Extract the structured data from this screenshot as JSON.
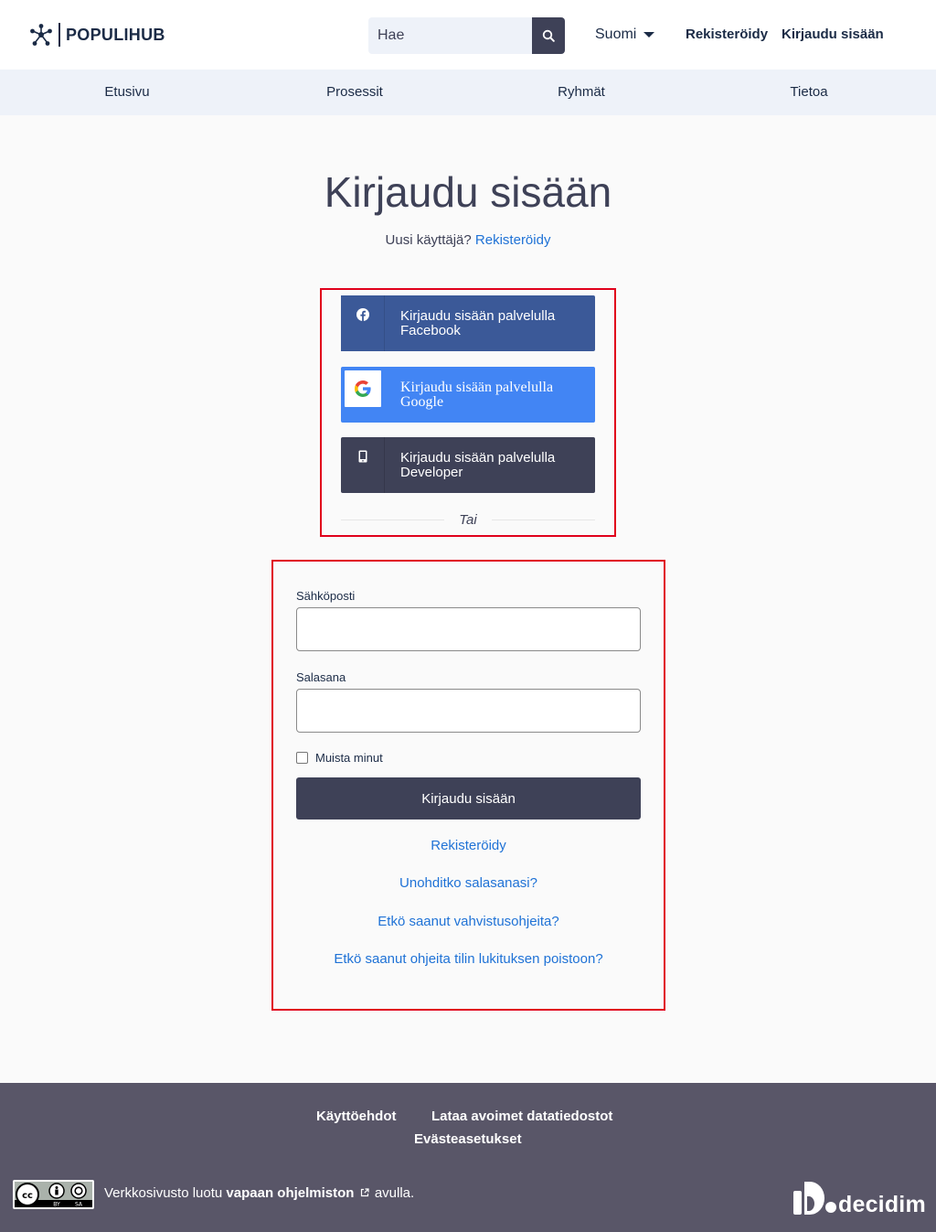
{
  "header": {
    "logo_text": "POPULIHUB",
    "search_placeholder": "Hae",
    "language": "Suomi",
    "register_link": "Rekisteröidy",
    "login_link": "Kirjaudu sisään"
  },
  "nav": {
    "items": [
      "Etusivu",
      "Prosessit",
      "Ryhmät",
      "Tietoa"
    ]
  },
  "main": {
    "title": "Kirjaudu sisään",
    "new_user_text": "Uusi käyttäjä?",
    "register_link": "Rekisteröidy"
  },
  "social": {
    "facebook_label": "Kirjaudu sisään palvelulla Facebook",
    "google_label": "Kirjaudu sisään palvelulla Google",
    "developer_label": "Kirjaudu sisään palvelulla Developer",
    "or_text": "Tai"
  },
  "form": {
    "email_label": "Sähköposti",
    "password_label": "Salasana",
    "remember_label": "Muista minut",
    "submit_label": "Kirjaudu sisään",
    "links": [
      "Rekisteröidy",
      "Unohditko salasanasi?",
      "Etkö saanut vahvistusohjeita?",
      "Etkö saanut ohjeita tilin lukituksen poistoon?"
    ]
  },
  "footer": {
    "terms": "Käyttöehdot",
    "open_data": "Lataa avoimet datatiedostot",
    "cookies": "Evästeasetukset",
    "credit_before": "Verkkosivusto luotu",
    "credit_link": "vapaan ohjelmiston",
    "credit_after": "avulla.",
    "license_badge": "cc-by-sa-icon",
    "brand": "decidim"
  },
  "colors": {
    "primary": "#3e4157",
    "link": "#1f72d6",
    "facebook": "#3b5998",
    "google": "#4285f4",
    "highlight": "#e0001b",
    "footer": "#595668"
  }
}
